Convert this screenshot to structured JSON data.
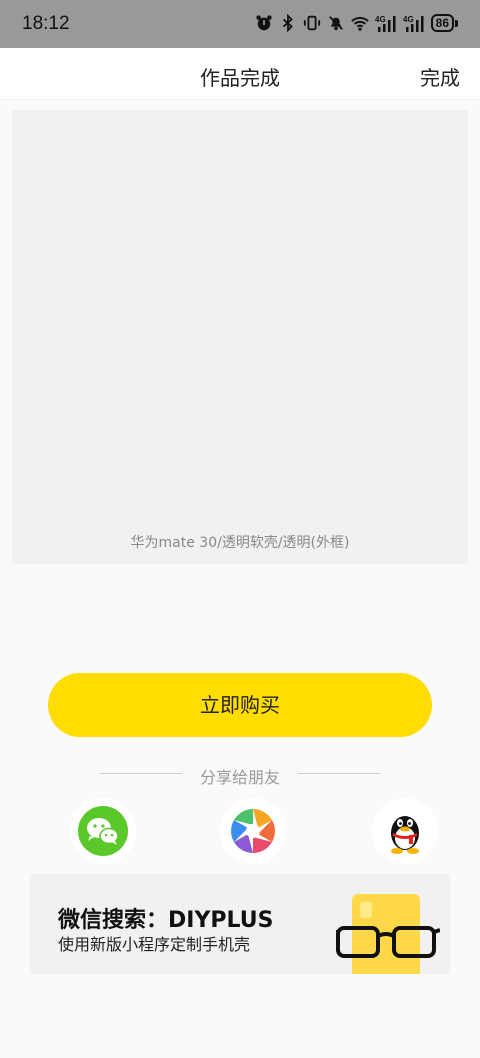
{
  "status_bar": {
    "time": "18:12",
    "battery": "86",
    "icons": [
      "alarm-icon",
      "bluetooth-icon",
      "vibrate-icon",
      "mute-icon",
      "wifi-icon",
      "signal-4g-icon",
      "signal-4g-icon"
    ]
  },
  "nav": {
    "title": "作品完成",
    "done_label": "完成"
  },
  "preview": {
    "caption": "华为mate 30/透明软壳/透明(外框)"
  },
  "buy": {
    "label": "立即购买",
    "color": "#ffdd00"
  },
  "share": {
    "title": "分享给朋友",
    "targets": [
      "wechat-icon",
      "moments-icon",
      "qq-icon"
    ]
  },
  "ad": {
    "title": "微信搜索：DIYPLUS",
    "subtitle": "使用新版小程序定制手机壳"
  }
}
